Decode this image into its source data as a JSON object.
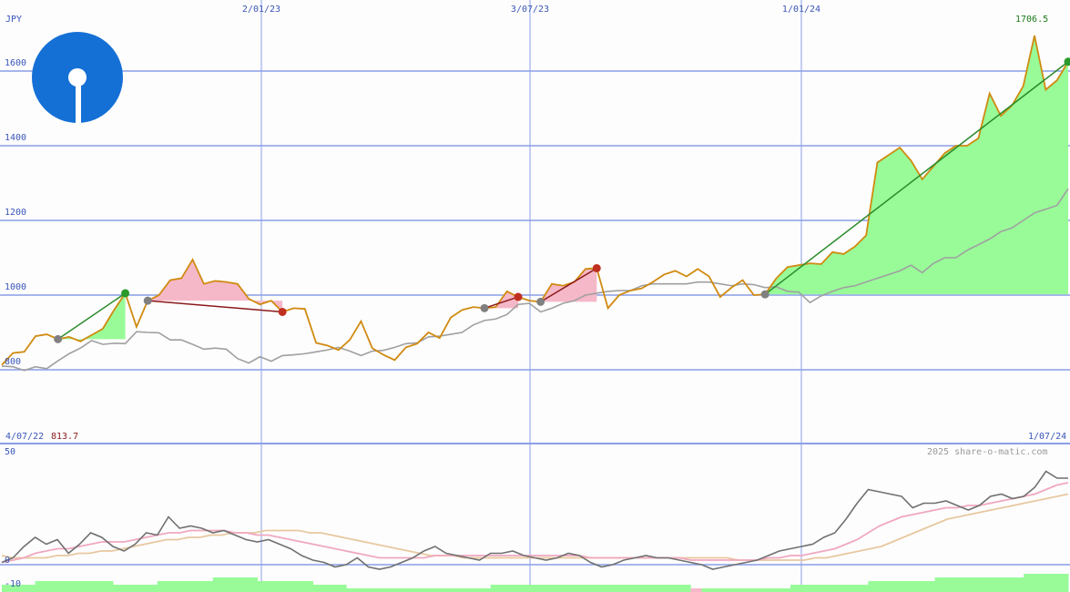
{
  "colors": {
    "grid": "#8a9fe6",
    "price": "#d08a10",
    "avg": "#a0a0a0",
    "gain_fill": "#98fb98",
    "loss_fill": "#f5b8c8",
    "trend_up": "#2a8a2a",
    "trend_down": "#8b1a1a",
    "logo": "#1570d6",
    "last_price": "#1a7a1a",
    "start_price": "#8b1a1a",
    "osc": "#707070",
    "osc_ma_fast": "#f0a8c0",
    "osc_ma_slow": "#e8c8a0",
    "vol_up": "#98fb98",
    "vol_down": "#f5b8c8"
  },
  "labels": {
    "currency": "JPY",
    "start_date": "4/07/22",
    "start_price": "813.7",
    "end_date": "1/07/24",
    "last_price": "1706.5",
    "copyright": "2025 share-o-matic.com",
    "logo_icon": "bank-logo-icon"
  },
  "chart_data": [
    {
      "type": "line",
      "name": "price-chart",
      "x_ticks": [
        "2/01/23",
        "3/07/23",
        "1/01/24"
      ],
      "y_ticks": [
        800,
        1000,
        1200,
        1400,
        1600
      ],
      "ylim": [
        720,
        1700
      ],
      "grid": true,
      "series": [
        {
          "key": "price",
          "values": [
            813,
            845,
            848,
            890,
            895,
            882,
            888,
            876,
            893,
            910,
            960,
            1005,
            915,
            985,
            1000,
            1040,
            1045,
            1095,
            1030,
            1038,
            1035,
            1030,
            990,
            975,
            985,
            955,
            965,
            963,
            872,
            865,
            853,
            880,
            930,
            858,
            840,
            826,
            860,
            870,
            900,
            885,
            940,
            960,
            968,
            965,
            968,
            1010,
            995,
            985,
            982,
            1030,
            1025,
            1035,
            1070,
            1072,
            965,
            1000,
            1012,
            1018,
            1035,
            1055,
            1065,
            1050,
            1070,
            1050,
            995,
            1020,
            1040,
            1000,
            1002,
            1045,
            1075,
            1080,
            1085,
            1083,
            1115,
            1110,
            1130,
            1160,
            1355,
            1375,
            1395,
            1360,
            1310,
            1345,
            1380,
            1400,
            1400,
            1420,
            1540,
            1480,
            1508,
            1560,
            1695,
            1550,
            1575,
            1625
          ]
        },
        {
          "key": "avg",
          "values": [
            810,
            808,
            798,
            808,
            803,
            824,
            843,
            858,
            878,
            868,
            871,
            870,
            902,
            900,
            899,
            880,
            880,
            868,
            855,
            858,
            855,
            830,
            818,
            835,
            823,
            838,
            840,
            843,
            848,
            853,
            860,
            850,
            838,
            850,
            852,
            860,
            870,
            872,
            888,
            890,
            895,
            900,
            920,
            932,
            936,
            948,
            975,
            978,
            955,
            965,
            978,
            985,
            1000,
            1005,
            1010,
            1012,
            1012,
            1025,
            1030,
            1030,
            1030,
            1030,
            1035,
            1035,
            1030,
            1025,
            1030,
            1028,
            1020,
            1022,
            1010,
            1008,
            980,
            998,
            1010,
            1020,
            1025,
            1035,
            1045,
            1055,
            1065,
            1080,
            1060,
            1085,
            1100,
            1100,
            1120,
            1135,
            1150,
            1170,
            1180,
            1200,
            1220,
            1230,
            1240,
            1285
          ]
        }
      ],
      "trades": [
        {
          "entry_index": 5,
          "exit_index": 11,
          "result": "gain"
        },
        {
          "entry_index": 13,
          "exit_index": 25,
          "result": "loss"
        },
        {
          "entry_index": 43,
          "exit_index": 46,
          "result": "loss"
        },
        {
          "entry_index": 48,
          "exit_index": 53,
          "result": "loss"
        },
        {
          "entry_index": 68,
          "exit_index": 95,
          "result": "gain"
        }
      ]
    },
    {
      "type": "line",
      "name": "oscillator-chart",
      "y_ticks": [
        50,
        0,
        -10
      ],
      "ylim": [
        -10,
        50
      ],
      "series": [
        {
          "key": "osc",
          "values": [
            1,
            3,
            8,
            12,
            9,
            11,
            5,
            9,
            14,
            12,
            8,
            6,
            9,
            14,
            13,
            21,
            16,
            17,
            16,
            14,
            15,
            13,
            11,
            10,
            11,
            9,
            7,
            4,
            2,
            1,
            -1,
            0,
            3,
            -1,
            -2,
            -1,
            1,
            3,
            6,
            8,
            5,
            4,
            3,
            2,
            5,
            5,
            6,
            4,
            3,
            2,
            3,
            5,
            4,
            1,
            -1,
            0,
            2,
            3,
            4,
            3,
            3,
            2,
            1,
            0,
            -2,
            -1,
            0,
            1,
            2,
            4,
            6,
            7,
            8,
            9,
            12,
            14,
            20,
            27,
            33,
            32,
            31,
            30,
            25,
            27,
            27,
            28,
            26,
            24,
            26,
            30,
            31,
            29,
            30,
            34,
            41,
            38,
            38
          ]
        },
        {
          "key": "osc_ma_fast",
          "values": [
            1,
            2,
            3,
            5,
            6,
            7,
            7,
            8,
            9,
            10,
            10,
            10,
            11,
            12,
            13,
            14,
            14,
            15,
            15,
            15,
            15,
            14,
            14,
            13,
            13,
            12,
            11,
            10,
            9,
            8,
            7,
            6,
            5,
            4,
            3,
            3,
            3,
            3,
            3,
            4,
            4,
            4,
            4,
            4,
            4,
            4,
            4,
            4,
            4,
            4,
            4,
            4,
            4,
            3,
            3,
            3,
            3,
            3,
            3,
            3,
            3,
            3,
            2,
            2,
            2,
            2,
            2,
            2,
            2,
            3,
            3,
            4,
            4,
            5,
            6,
            7,
            9,
            11,
            14,
            17,
            19,
            21,
            22,
            23,
            24,
            25,
            25,
            26,
            26,
            27,
            28,
            29,
            30,
            31,
            33,
            35,
            36
          ]
        },
        {
          "key": "osc_ma_slow",
          "values": [
            4,
            3,
            3,
            3,
            3,
            4,
            4,
            5,
            5,
            6,
            6,
            7,
            8,
            9,
            10,
            11,
            11,
            12,
            12,
            13,
            13,
            14,
            14,
            14,
            15,
            15,
            15,
            15,
            14,
            14,
            13,
            12,
            11,
            10,
            9,
            8,
            7,
            6,
            5,
            4,
            4,
            4,
            3,
            3,
            3,
            3,
            3,
            3,
            3,
            3,
            3,
            3,
            3,
            3,
            3,
            3,
            3,
            3,
            3,
            3,
            3,
            3,
            3,
            3,
            3,
            3,
            3,
            2,
            2,
            2,
            2,
            2,
            2,
            2,
            3,
            3,
            4,
            5,
            6,
            7,
            8,
            10,
            12,
            14,
            16,
            18,
            20,
            21,
            22,
            23,
            24,
            25,
            26,
            27,
            28,
            29,
            30,
            31
          ]
        }
      ]
    },
    {
      "type": "bar",
      "name": "volume-bars",
      "values": [
        2,
        2,
        2,
        3,
        3,
        3,
        3,
        3,
        3,
        3,
        2,
        2,
        2,
        2,
        3,
        3,
        3,
        3,
        3,
        4,
        4,
        4,
        4,
        3,
        3,
        3,
        3,
        3,
        2,
        2,
        2,
        1,
        1,
        1,
        1,
        1,
        1,
        1,
        1,
        1,
        1,
        1,
        1,
        1,
        2,
        2,
        2,
        2,
        2,
        2,
        2,
        2,
        2,
        2,
        2,
        2,
        2,
        2,
        2,
        2,
        2,
        2,
        1,
        1,
        1,
        1,
        1,
        1,
        1,
        1,
        1,
        2,
        2,
        2,
        2,
        2,
        2,
        2,
        3,
        3,
        3,
        3,
        3,
        3,
        4,
        4,
        4,
        4,
        4,
        4,
        4,
        4,
        5,
        5,
        5,
        5
      ],
      "down_indices": [
        62
      ]
    }
  ]
}
